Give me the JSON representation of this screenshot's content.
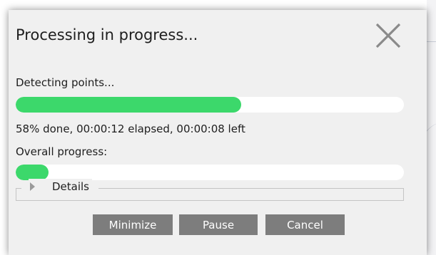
{
  "dialog": {
    "title": "Processing in progress...",
    "close_icon": "close-x-icon"
  },
  "current_task": {
    "label": "Detecting points...",
    "progress_fraction": 0.58,
    "status_text": "58% done, 00:00:12 elapsed, 00:00:08 left"
  },
  "overall": {
    "label": "Overall progress:",
    "progress_fraction": 0.085
  },
  "details": {
    "label": "Details",
    "expanded": false,
    "icon": "triangle-right-icon"
  },
  "buttons": {
    "minimize": "Minimize",
    "pause": "Pause",
    "cancel": "Cancel"
  },
  "colors": {
    "progress_fill": "#3cd86b",
    "progress_track": "#ffffff",
    "dialog_background": "#f0f0f0",
    "button_background": "#7d7d7d",
    "button_text": "#ffffff"
  }
}
